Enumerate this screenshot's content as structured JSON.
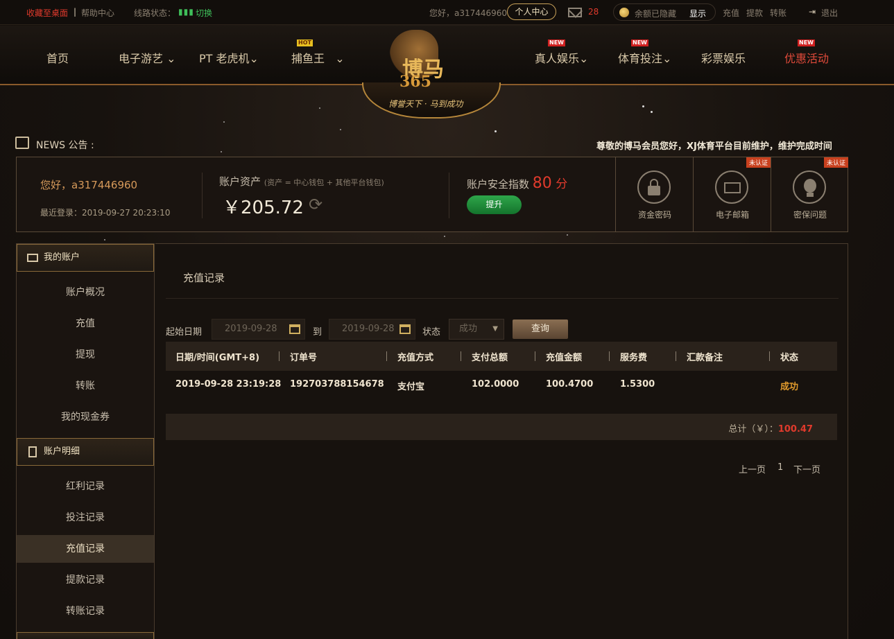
{
  "topbar": {
    "bookmark": "收藏至桌面",
    "help": "帮助中心",
    "line_status": "线路状态：",
    "switch": "切换",
    "greeting": "您好，a317446960",
    "personal_center": "个人中心",
    "mail_count": "28",
    "balance_hidden": "余额已隐藏",
    "show": "显示",
    "deposit": "充值",
    "withdraw": "提款",
    "transfer": "转账",
    "logout": "退出"
  },
  "nav": {
    "home": "首页",
    "slots": "电子游艺",
    "pt": "PT 老虎机",
    "fishing": "捕鱼王",
    "live": "真人娱乐",
    "sports": "体育投注",
    "lottery": "彩票娱乐",
    "promotions": "优惠活动",
    "hot_badge": "HOT",
    "new_badge": "NEW"
  },
  "brand": {
    "name": "博马",
    "number": "365",
    "slogan": "博誉天下 · 马到成功"
  },
  "news": {
    "label": "NEWS 公告 :",
    "text": "尊敬的博马会员您好，XJ体育平台目前维护，维护完成时间"
  },
  "account": {
    "greeting": "您好，a317446960",
    "last_login": "最近登录：2019-09-27 20:23:10",
    "assets_label": "账户资产",
    "assets_note": "(资产 = 中心钱包 + 其他平台钱包)",
    "assets_amount": "￥205.72",
    "security_label": "账户安全指数",
    "security_score": "80",
    "security_unit": " 分",
    "upgrade": "提升"
  },
  "security": {
    "unverified": "未认证",
    "items": [
      {
        "label": "资金密码",
        "icon": "lock-icon"
      },
      {
        "label": "电子邮箱",
        "icon": "envelope-icon"
      },
      {
        "label": "密保问题",
        "icon": "lightbulb-icon"
      }
    ]
  },
  "sidebar": {
    "section1": "我的账户",
    "items1": [
      "账户概况",
      "充值",
      "提现",
      "转账",
      "我的现金券"
    ],
    "section2": "账户明细",
    "items2": [
      "红利记录",
      "投注记录",
      "充值记录",
      "提款记录",
      "转账记录"
    ],
    "active": "充值记录"
  },
  "main": {
    "title": "充值记录"
  },
  "filter": {
    "start_label": "起始日期",
    "start_value": "2019-09-28",
    "to_label": "到",
    "end_value": "2019-09-28",
    "status_label": "状态",
    "status_value": "成功",
    "query": "查询"
  },
  "table": {
    "headers": [
      "日期/时间(GMT+8)",
      "订单号",
      "充值方式",
      "支付总额",
      "充值金额",
      "服务费",
      "汇款备注",
      "状态"
    ],
    "rows": [
      {
        "datetime": "2019-09-28 23:19:28",
        "order": "192703788154678",
        "method": "支付宝",
        "total_paid": "102.0000",
        "amount": "100.4700",
        "fee": "1.5300",
        "remark": "",
        "status": "成功"
      }
    ],
    "total_label": "总计（￥）：",
    "total_value": "100.47"
  },
  "pager": {
    "prev": "上一页",
    "page": "1",
    "next": "下一页"
  },
  "colors": {
    "accent_gold": "#c9a25a",
    "alert_red": "#e03a2c",
    "success_orange": "#e09a2c",
    "upgrade_green": "#2ea64a"
  }
}
